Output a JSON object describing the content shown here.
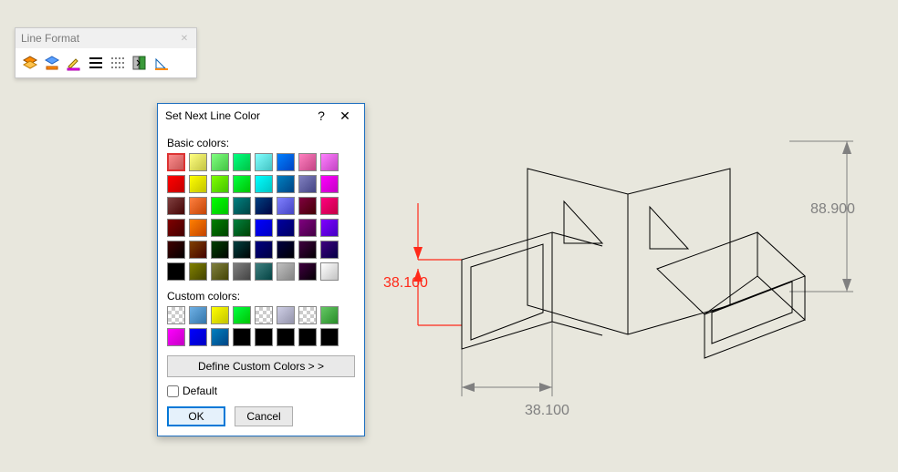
{
  "toolbar": {
    "title": "Line Format",
    "buttons": [
      {
        "name": "layer-properties",
        "icon": "layer"
      },
      {
        "name": "line-color",
        "icon": "line-color"
      },
      {
        "name": "line-thickness",
        "icon": "thickness"
      },
      {
        "name": "line-style",
        "icon": "style"
      },
      {
        "name": "hide-show-edges",
        "icon": "hide-show"
      },
      {
        "name": "color-display-mode",
        "icon": "color-mode"
      },
      {
        "name": "line-format-angle",
        "icon": "angle"
      }
    ]
  },
  "dialog": {
    "title": "Set Next Line Color",
    "help_symbol": "?",
    "labels": {
      "basic": "Basic colors:",
      "custom": "Custom colors:",
      "define": "Define Custom Colors > >",
      "default": "Default",
      "ok": "OK",
      "cancel": "Cancel"
    },
    "basic_colors": [
      "#ff8f8f",
      "#ffff80",
      "#80ff80",
      "#00ff80",
      "#80ffff",
      "#0080ff",
      "#ff80c0",
      "#ff80ff",
      "#ff0000",
      "#ffff00",
      "#80ff00",
      "#00ff40",
      "#00ffff",
      "#0080c0",
      "#8080c0",
      "#ff00ff",
      "#804040",
      "#ff8040",
      "#00ff00",
      "#008080",
      "#004080",
      "#8080ff",
      "#800040",
      "#ff0080",
      "#800000",
      "#ff8000",
      "#008000",
      "#008040",
      "#0000ff",
      "#0000a0",
      "#800080",
      "#8000ff",
      "#400000",
      "#804000",
      "#004000",
      "#004040",
      "#000080",
      "#000040",
      "#400040",
      "#400080",
      "#000000",
      "#808000",
      "#808040",
      "#808080",
      "#408080",
      "#c0c0c0",
      "#400040",
      "#ffffff"
    ],
    "selected_basic": 0,
    "custom_colors": [
      "#ffffff",
      "#6fb1e6",
      "#ffff00",
      "#00ff40",
      "#ffffff",
      "#cfcfe6",
      "#ffffff",
      "#64c864",
      "#ff00ff",
      "#0000ff",
      "#0080c0",
      "#000000",
      "#000000",
      "#000000",
      "#000000",
      "#000000"
    ],
    "default_checked": false
  },
  "drawing": {
    "dim_height": "38.100",
    "dim_width": "38.100",
    "dim_overall": "88.900"
  }
}
